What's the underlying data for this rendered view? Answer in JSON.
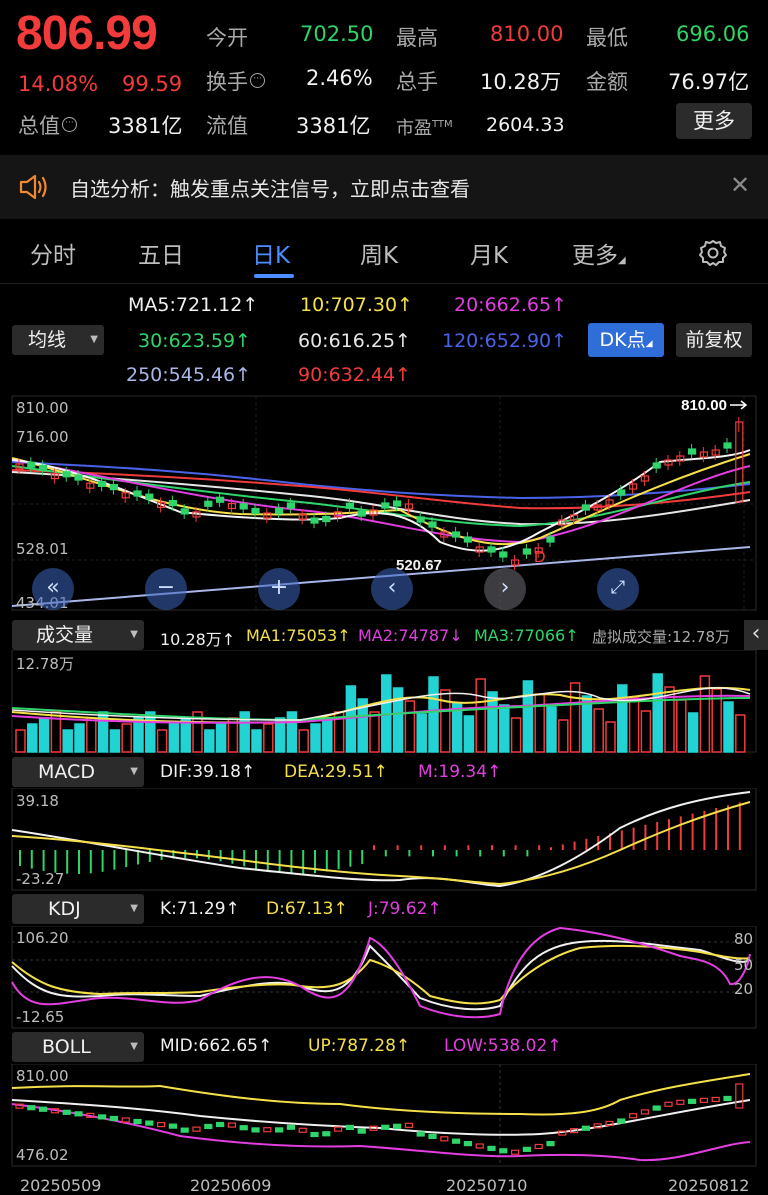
{
  "quote": {
    "price": "806.99",
    "change_pct": "14.08%",
    "change": "99.59",
    "open_label": "今开",
    "open": "702.50",
    "high_label": "最高",
    "high": "810.00",
    "low_label": "最低",
    "low": "696.06",
    "turnover_label": "换手",
    "turnover": "2.46%",
    "volume_label": "总手",
    "volume": "10.28万",
    "amount_label": "金额",
    "amount": "76.97亿",
    "mktcap_label": "总值",
    "mktcap": "3381亿",
    "float_label": "流值",
    "float": "3381亿",
    "pe_label": "市盈",
    "pe_sup": "TTM",
    "pe": "2604.33",
    "more_label": "更多"
  },
  "banner": {
    "text": "自选分析：触发重点关注信号，立即点击查看"
  },
  "tabs": [
    "分时",
    "五日",
    "日K",
    "周K",
    "月K",
    "更多"
  ],
  "active_tab": 2,
  "ma": {
    "selector": "均线",
    "ma5": "MA5:721.12↑",
    "ma10": "10:707.30↑",
    "ma20": "20:662.65↑",
    "ma30": "30:623.59↑",
    "ma60": "60:616.25↑",
    "ma120": "120:652.90↑",
    "ma250": "250:545.46↑",
    "ma90": "90:632.44↑",
    "dk_label": "DK点",
    "fq_label": "前复权"
  },
  "kline": {
    "y_labels": [
      "810.00",
      "716.00",
      "528.01",
      "434.01"
    ],
    "high_marker": "810.00",
    "low_marker": "520.67",
    "d_marker": "D"
  },
  "volume": {
    "selector": "成交量",
    "vol": "10.28万↑",
    "ma1": "MA1:75053↑",
    "ma2": "MA2:74787↓",
    "ma3": "MA3:77066↑",
    "virtual": "虚拟成交量:12.78万",
    "y_max": "12.78万"
  },
  "macd": {
    "selector": "MACD",
    "dif": "DIF:39.18↑",
    "dea": "DEA:29.51↑",
    "m": "M:19.34↑",
    "y_max": "39.18",
    "y_min": "-23.27"
  },
  "kdj": {
    "selector": "KDJ",
    "k": "K:71.29↑",
    "d": "D:67.13↑",
    "j": "J:79.62↑",
    "y_max": "106.20",
    "y_min": "-12.65",
    "r80": "80",
    "r50": "50",
    "r20": "20"
  },
  "boll": {
    "selector": "BOLL",
    "mid": "MID:662.65↑",
    "up": "UP:787.28↑",
    "low": "LOW:538.02↑",
    "y_max": "810.00",
    "y_min": "476.02"
  },
  "dates": [
    "20250509",
    "20250609",
    "20250710",
    "20250812"
  ],
  "colors": {
    "up": "#f23b3b",
    "down": "#2fd46a",
    "accent": "#4d8dff"
  }
}
